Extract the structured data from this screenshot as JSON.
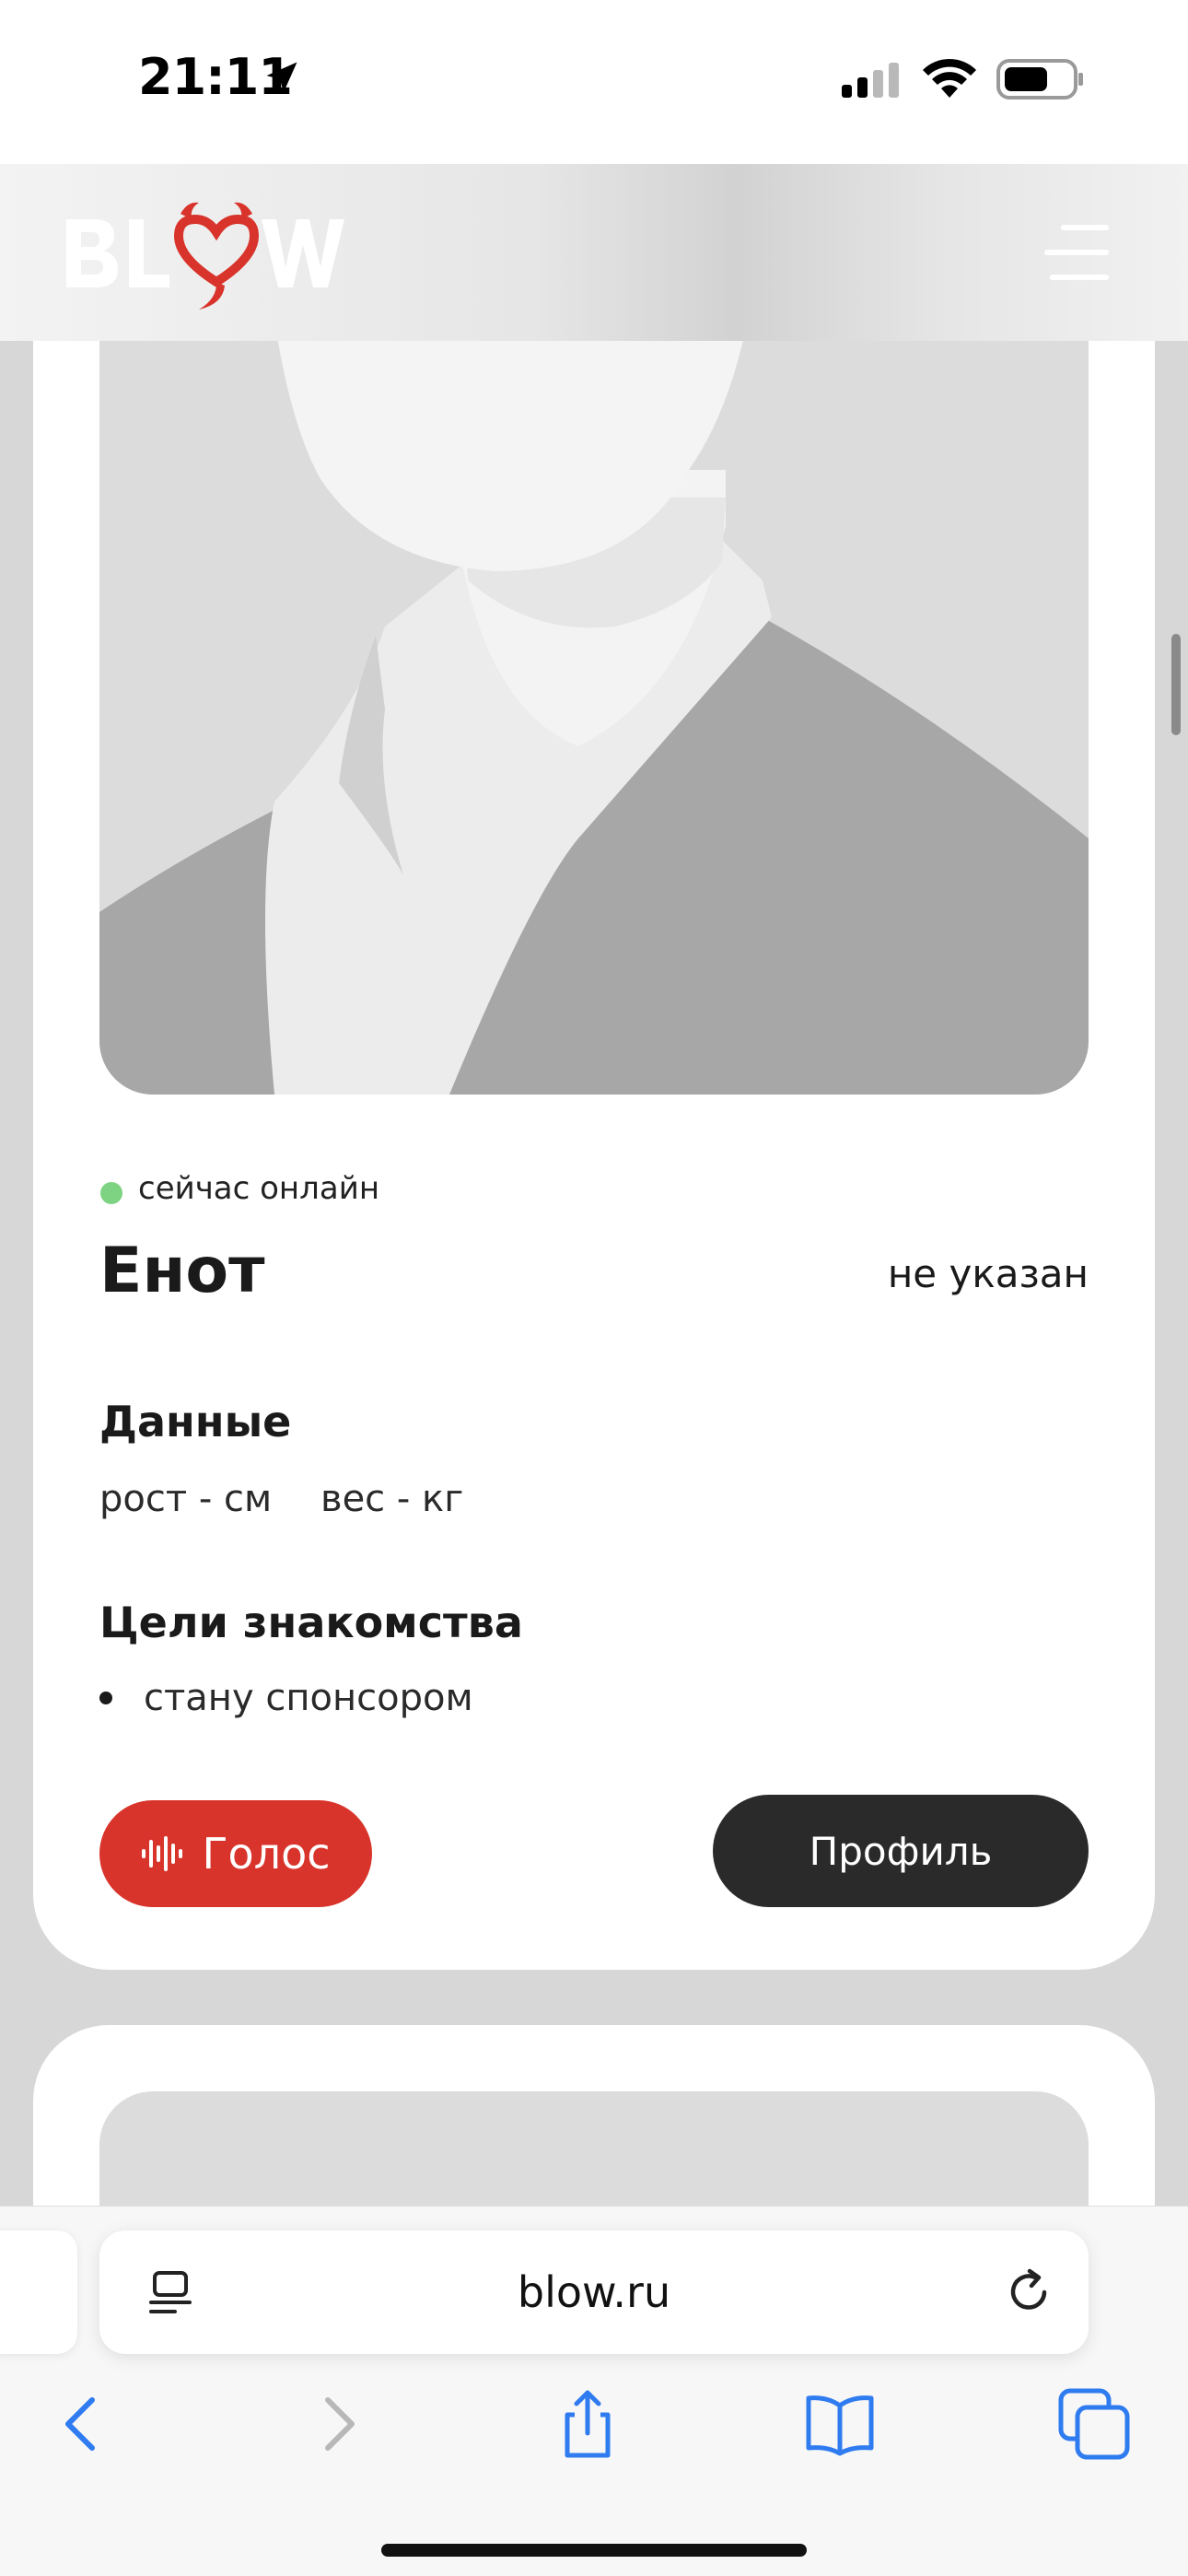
{
  "status_bar": {
    "time": "21:11"
  },
  "header": {
    "logo_text": "BLOW",
    "accent_color": "#d8342b"
  },
  "profile_card": {
    "online_status": "сейчас онлайн",
    "online_color": "#7ed383",
    "name": "Енот",
    "gender": "не указан",
    "data_section": {
      "title": "Данные",
      "height": "рост - см",
      "weight": "вес - кг"
    },
    "goals_section": {
      "title": "Цели знакомства",
      "items": [
        "стану спонсором"
      ]
    },
    "voice_button": "Голос",
    "profile_button": "Профиль"
  },
  "browser": {
    "url": "blow.ru"
  }
}
